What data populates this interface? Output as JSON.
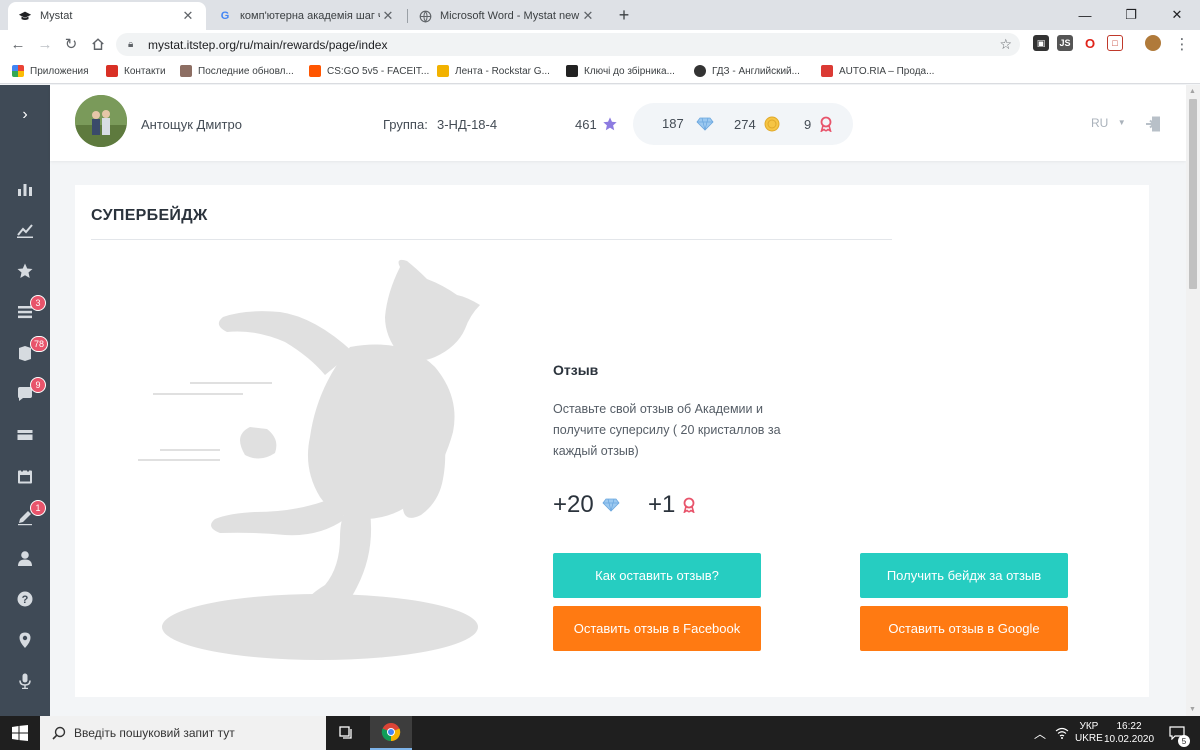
{
  "browser": {
    "tabs": [
      {
        "title": "Mystat",
        "active": true
      },
      {
        "title": "комп'ютерна академія шаг черк",
        "active": false
      },
      {
        "title": "Microsoft Word - Mystat new",
        "active": false
      }
    ],
    "new_tab_label": "+",
    "url": "mystat.itstep.org/ru/main/rewards/page/index",
    "bookmarks": [
      {
        "label": "Приложения",
        "color": "#4285f4"
      },
      {
        "label": "Контакти",
        "color": "#d93025"
      },
      {
        "label": "Последние обновл...",
        "color": "#8d6e63"
      },
      {
        "label": "CS:GO 5v5 - FACEIT...",
        "color": "#ff5500"
      },
      {
        "label": "Лента - Rockstar G...",
        "color": "#f2b200"
      },
      {
        "label": "Ключі до збірника...",
        "color": "#222222"
      },
      {
        "label": "ГДЗ - Английский...",
        "color": "#333333"
      },
      {
        "label": "AUTO.RIA – Прода...",
        "color": "#db3a34"
      }
    ]
  },
  "sidebar": {
    "items": [
      {
        "icon": "bar-chart-icon",
        "badge": ""
      },
      {
        "icon": "line-chart-icon",
        "badge": ""
      },
      {
        "icon": "star-icon",
        "badge": ""
      },
      {
        "icon": "list-icon",
        "badge": "3"
      },
      {
        "icon": "books-icon",
        "badge": "78"
      },
      {
        "icon": "chat-icon",
        "badge": "9"
      },
      {
        "icon": "credit-card-icon",
        "badge": ""
      },
      {
        "icon": "calendar-icon",
        "badge": ""
      },
      {
        "icon": "pencil-icon",
        "badge": "1"
      },
      {
        "icon": "user-icon",
        "badge": ""
      },
      {
        "icon": "help-icon",
        "badge": ""
      },
      {
        "icon": "location-icon",
        "badge": ""
      },
      {
        "icon": "microphone-icon",
        "badge": ""
      }
    ]
  },
  "header": {
    "user_name": "Антощук Дмитро",
    "group_label": "Группа:",
    "group_value": "3-НД-18-4",
    "stars": "461",
    "crystals": "187",
    "coins": "274",
    "badges": "9",
    "language": "RU"
  },
  "card": {
    "title": "СУПЕРБЕЙДЖ",
    "badge_name": "Отзыв",
    "description": "Оставьте свой отзыв об Академии и получите суперсилу ( 20 кристаллов за каждый отзыв)",
    "reward_crystals": "+20",
    "reward_badges": "+1",
    "buttons": {
      "how_to": "Как оставить отзыв?",
      "get_badge": "Получить бейдж за отзыв",
      "facebook": "Оставить отзыв в Facebook",
      "google": "Оставить отзыв в Google"
    }
  },
  "taskbar": {
    "search_placeholder": "Введіть пошуковий запит тут",
    "language_top": "УКР",
    "language_bottom": "UKRE",
    "time": "16:22",
    "date": "10.02.2020",
    "notifications": "5"
  },
  "colors": {
    "accent_teal": "#26cdc1",
    "accent_orange": "#ff7a12",
    "sidebar_bg": "#3f4a56",
    "badge_red": "#e8546b"
  }
}
